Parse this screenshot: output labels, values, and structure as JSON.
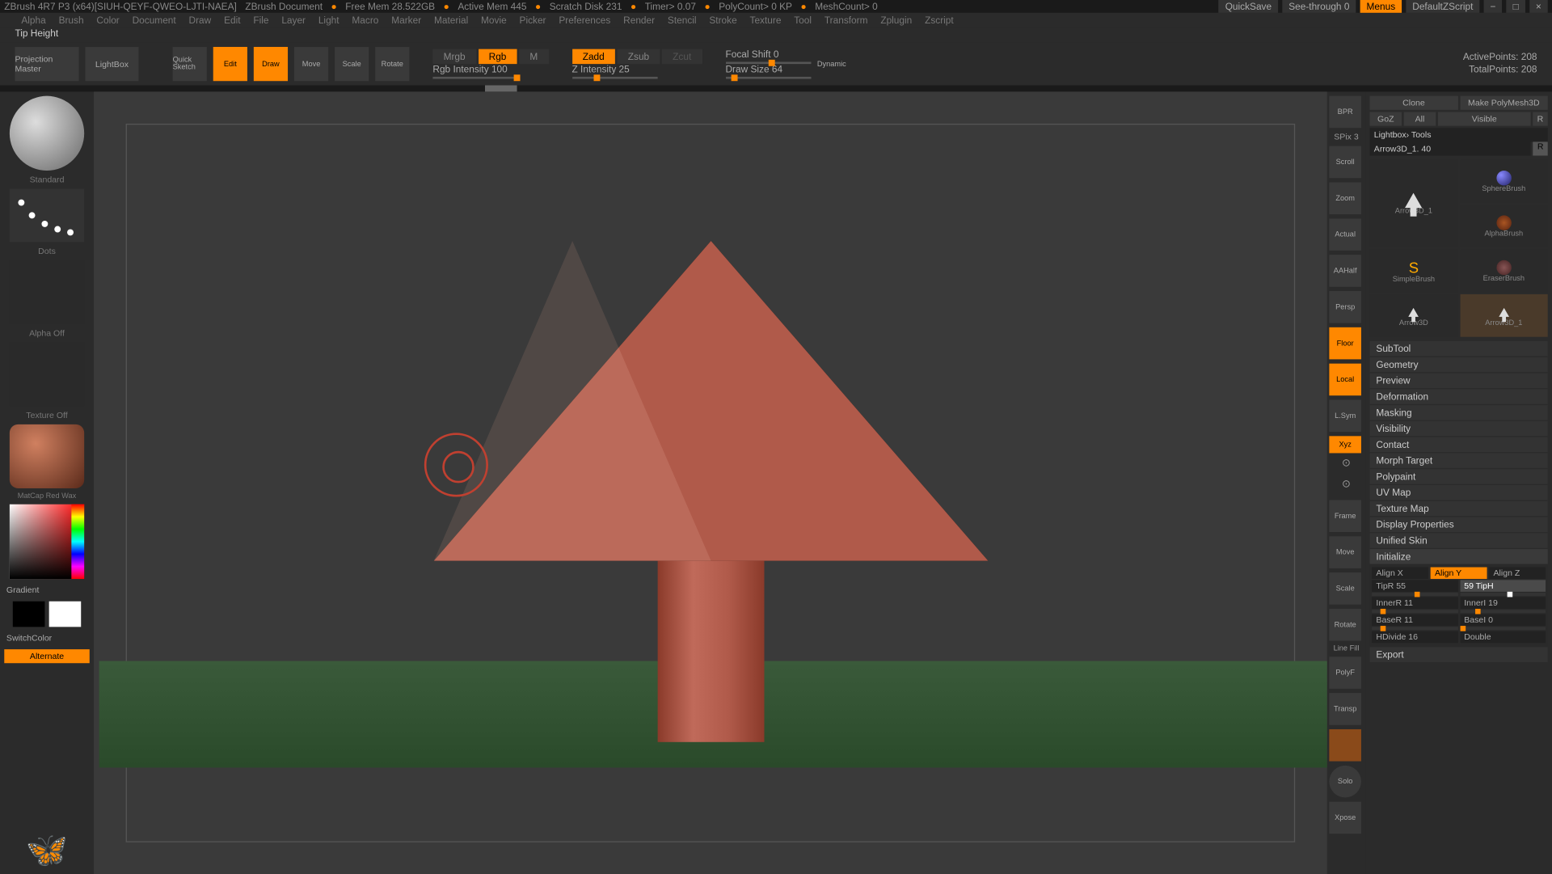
{
  "titlebar": {
    "app": "ZBrush 4R7 P3 (x64)[SIUH-QEYF-QWEO-LJTI-NAEA]",
    "doc": "ZBrush Document",
    "freemem": "Free Mem 28.522GB",
    "activemem": "Active Mem 445",
    "scratch": "Scratch Disk 231",
    "timer": "Timer> 0.07",
    "polycount": "PolyCount> 0 KP",
    "meshcount": "MeshCount> 0",
    "quicksave": "QuickSave",
    "seethrough": "See-through  0",
    "menus": "Menus",
    "defaultscript": "DefaultZScript"
  },
  "menu": [
    "Alpha",
    "Brush",
    "Color",
    "Document",
    "Draw",
    "Edit",
    "File",
    "Layer",
    "Light",
    "Macro",
    "Marker",
    "Material",
    "Movie",
    "Picker",
    "Preferences",
    "Render",
    "Stencil",
    "Stroke",
    "Texture",
    "Tool",
    "Transform",
    "Zplugin",
    "Zscript"
  ],
  "status": "Tip Height",
  "toolbar": {
    "projection": "Projection\nMaster",
    "lightbox": "LightBox",
    "quicksketch": "Quick\nSketch",
    "edit": "Edit",
    "draw": "Draw",
    "move": "Move",
    "scale": "Scale",
    "rotate": "Rotate",
    "mrgb": "Mrgb",
    "rgb": "Rgb",
    "m": "M",
    "rgbint": "Rgb Intensity 100",
    "zadd": "Zadd",
    "zsub": "Zsub",
    "zcut": "Zcut",
    "zint": "Z Intensity 25",
    "focal": "Focal Shift 0",
    "drawsize": "Draw Size 64",
    "dynamic": "Dynamic",
    "activepoints": "ActivePoints: 208",
    "totalpoints": "TotalPoints: 208"
  },
  "left": {
    "standard": "Standard",
    "dots": "Dots",
    "alpha": "Alpha Off",
    "texture": "Texture Off",
    "material": "MatCap Red Wax",
    "gradient": "Gradient",
    "switchcolor": "SwitchColor",
    "alternate": "Alternate"
  },
  "dock": {
    "bpr": "BPR",
    "spix": "SPix 3",
    "scroll": "Scroll",
    "zoom": "Zoom",
    "actual": "Actual",
    "aahalf": "AAHalf",
    "persp": "Persp",
    "floor": "Floor",
    "local": "Local",
    "lsym": "L.Sym",
    "xyz": "Xyz",
    "frame": "Frame",
    "move": "Move",
    "scale": "Scale",
    "rotate": "Rotate",
    "linefill": "Line Fill",
    "polyf": "PolyF",
    "transp": "Transp",
    "solo": "Solo",
    "xpose": "Xpose"
  },
  "right": {
    "clone": "Clone",
    "makepoly": "Make PolyMesh3D",
    "goz": "GoZ",
    "all": "All",
    "visible": "Visible",
    "r": "R",
    "breadcrumb": "Lightbox› Tools",
    "toolname": "Arrow3D_1. 40",
    "r2": "R",
    "tools": {
      "arrow3d1": "Arrow3D_1",
      "spherebrush": "SphereBrush",
      "alphabrush": "AlphaBrush",
      "simplebrush": "SimpleBrush",
      "eraserbrush": "EraserBrush",
      "arrow3d": "Arrow3D",
      "arrow3d1b": "Arrow3D_1"
    },
    "sections": [
      "SubTool",
      "Geometry",
      "Preview",
      "Deformation",
      "Masking",
      "Visibility",
      "Contact",
      "Morph Target",
      "Polypaint",
      "UV Map",
      "Texture Map",
      "Display Properties",
      "Unified Skin",
      "Initialize",
      "Export"
    ],
    "init": {
      "alignx": "Align X",
      "aligny": "Align Y",
      "alignz": "Align Z",
      "tipr": "TipR 55",
      "tiph": "59 TipH",
      "innerr": "InnerR 11",
      "inneri": "InnerI 19",
      "baser": "BaseR 11",
      "basei": "BaseI 0",
      "hdivide": "HDivide 16",
      "double": "Double"
    }
  }
}
